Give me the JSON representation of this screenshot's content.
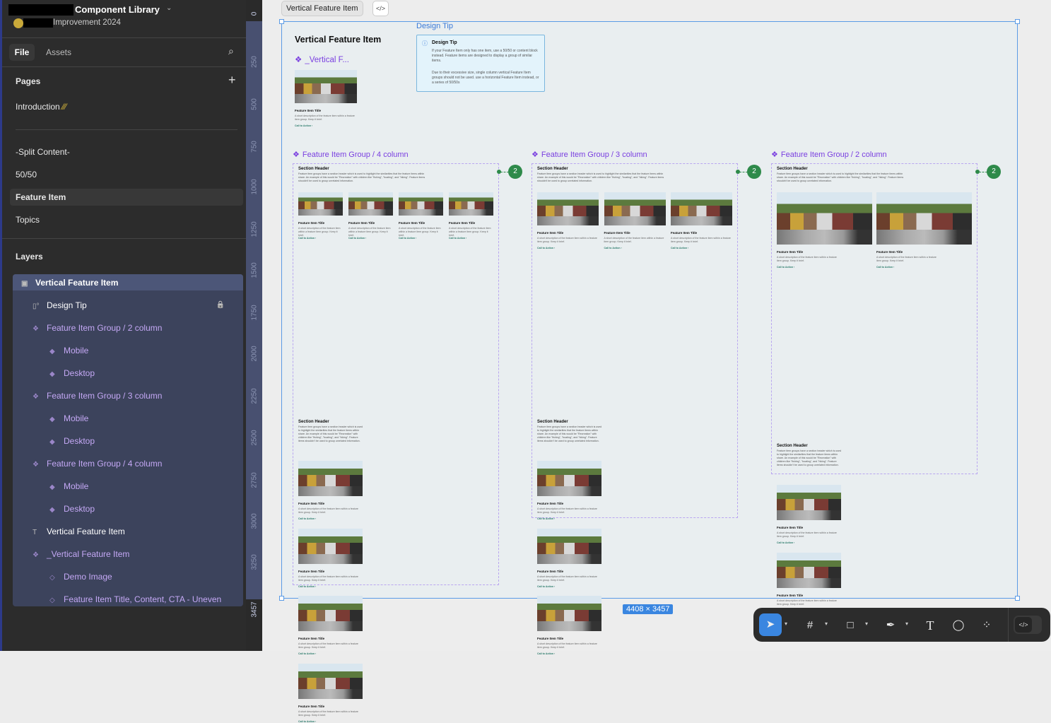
{
  "file": {
    "title": "Component Library",
    "subtitle": "Improvement 2024"
  },
  "tabs": {
    "file": "File",
    "assets": "Assets"
  },
  "pages": {
    "heading": "Pages",
    "items": [
      "Introduction",
      "-Split Content-",
      "50/50",
      "Feature Item",
      "Topics"
    ],
    "selected": "Feature Item"
  },
  "layers": {
    "heading": "Layers",
    "items": [
      {
        "label": "Vertical Feature Item",
        "icon": "frame-icon"
      },
      {
        "label": "Design Tip",
        "icon": "section-icon"
      },
      {
        "label": "Feature Item Group / 2 column",
        "icon": "component-set-icon"
      },
      {
        "label": "Mobile",
        "icon": "component-icon"
      },
      {
        "label": "Desktop",
        "icon": "component-icon"
      },
      {
        "label": "Feature Item Group / 3 column",
        "icon": "component-set-icon"
      },
      {
        "label": "Mobile",
        "icon": "component-icon"
      },
      {
        "label": "Desktop",
        "icon": "component-icon"
      },
      {
        "label": "Feature Item Group / 4 column",
        "icon": "component-set-icon"
      },
      {
        "label": "Mobile",
        "icon": "component-icon"
      },
      {
        "label": "Desktop",
        "icon": "component-icon"
      },
      {
        "label": "Vertical Feature Item",
        "icon": "text-icon"
      },
      {
        "label": "_Vertical Feature Item",
        "icon": "component-set-icon"
      },
      {
        "label": "Demo Image",
        "icon": "instance-icon"
      },
      {
        "label": "Feature Item Title, Content, CTA - Uneven",
        "icon": "instance-icon"
      }
    ]
  },
  "ruler": [
    "0",
    "250",
    "500",
    "750",
    "1000",
    "1250",
    "1500",
    "1750",
    "2000",
    "2250",
    "2500",
    "2750",
    "3000",
    "3250",
    "3457"
  ],
  "canvas": {
    "frame_tab": "Vertical Feature Item",
    "frame_title": "Vertical Feature Item",
    "component_label": "_Vertical F...",
    "size": "4408 × 3457",
    "design_tip": {
      "label": "Design Tip",
      "title": "Design Tip",
      "p1": "If your Feature Item only has one item, use a 50/50 or content block instead. Feature items are designed to display a group of similar items.",
      "p2": "Due to their excessive size, single column vertical Feature Item groups should not be used. use a horizontal Feature Item instead, or a series of 50/50s"
    },
    "card": {
      "title": "Feature Item Title",
      "desc": "A short description of the feature item within a feature item group. Keep it brief.",
      "cta": "Call to Action  ›"
    },
    "section": {
      "header": "Section Header",
      "desc": "Feature item groups have a section header which is used to highlight the similarities that the feature items within share. An example of this would be \"Recreation\" with children like \"fishing\", \"boating\", and \"hiking\". Feature items shouldn't be used to group unrelated information."
    },
    "groups": [
      {
        "label": "Feature Item Group / 4 column",
        "columns": 4,
        "badge": "2"
      },
      {
        "label": "Feature Item Group / 3 column",
        "columns": 3,
        "badge": "2"
      },
      {
        "label": "Feature Item Group / 2 column",
        "columns": 2,
        "badge": "2"
      }
    ]
  },
  "toolbar": [
    "move-tool",
    "frame-tool",
    "rectangle-tool",
    "pen-tool",
    "text-tool",
    "comment-tool",
    "actions-tool",
    "dev-mode-toggle"
  ],
  "colors": {
    "accent": "#3a86e0",
    "component": "#7a3fe0",
    "badge": "#2e8a4a"
  }
}
